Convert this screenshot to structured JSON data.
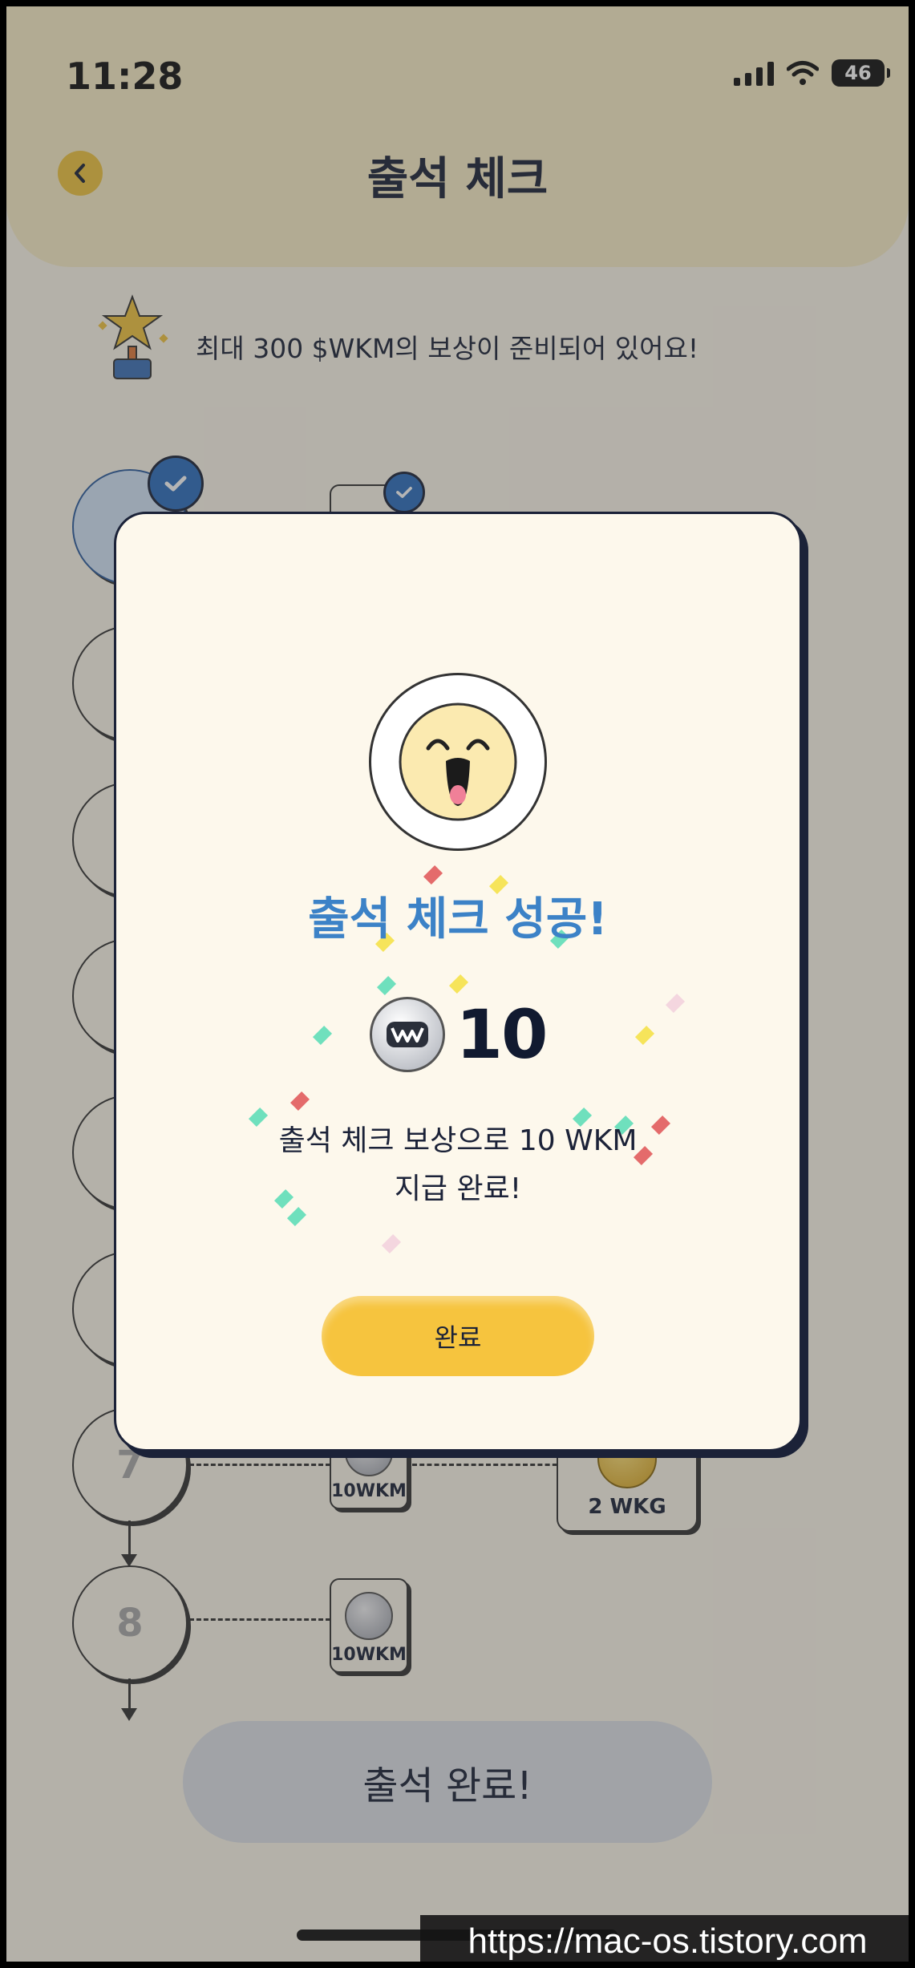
{
  "status_bar": {
    "time": "11:28",
    "battery": "46"
  },
  "header": {
    "title": "출석 체크"
  },
  "banner": {
    "text": "최대 300 $WKM의 보상이 준비되어 있어요!"
  },
  "days": [
    {
      "label": "",
      "checked": true
    },
    {
      "label": "",
      "checked": false
    },
    {
      "label": "",
      "checked": false
    },
    {
      "label": "",
      "checked": false
    },
    {
      "label": "",
      "checked": false
    },
    {
      "label": "",
      "checked": false
    },
    {
      "label": "7",
      "checked": false
    },
    {
      "label": "8",
      "checked": false
    }
  ],
  "rewards": {
    "row7_small": "10WKM",
    "row7_big": "2 WKG",
    "row8_small": "10WKM"
  },
  "complete_button": {
    "label": "출석 완료!"
  },
  "modal": {
    "title": "출석 체크 성공!",
    "amount": "10",
    "message_line1": "출석 체크 보상으로 10 WKM",
    "message_line2": "지급 완료!",
    "confirm_label": "완료"
  },
  "watermark": "https://mac-os.tistory.com",
  "colors": {
    "accent_yellow": "#f6c43e",
    "title_blue": "#3c82c7",
    "check_blue": "#2c6fbe"
  }
}
